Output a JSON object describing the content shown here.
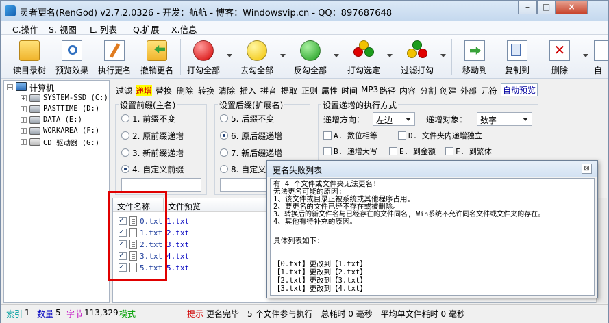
{
  "window": {
    "title": "灵者更名(RenGod) v2.7.2.0326 - 开发：航航 - 博客：Windowsvip.cn - QQ：897687648",
    "min_label": "–",
    "max_label": "□",
    "close_label": "×"
  },
  "menu": [
    "C.操作",
    "S. 视图",
    "L. 列表",
    "Q.扩展",
    "X.信息"
  ],
  "toolbar": {
    "buttons": [
      {
        "label": "读目录树",
        "icon": "folder-open-icon"
      },
      {
        "label": "预览效果",
        "icon": "preview-magnifier-icon"
      },
      {
        "label": "执行更名",
        "icon": "edit-document-icon"
      },
      {
        "label": "撤销更名",
        "icon": "undo-folder-icon"
      },
      {
        "label": "打勾全部",
        "icon": "red-circle-icon"
      },
      {
        "label": "去勾全部",
        "icon": "yellow-circle-icon"
      },
      {
        "label": "反勾全部",
        "icon": "green-circle-icon"
      },
      {
        "label": "打勾选定",
        "icon": "traffic-light-icon"
      },
      {
        "label": "过滤打勾",
        "icon": "traffic-filter-icon"
      },
      {
        "label": "移动到",
        "icon": "move-to-icon"
      },
      {
        "label": "复制到",
        "icon": "copy-to-icon"
      },
      {
        "label": "删除",
        "icon": "delete-icon"
      },
      {
        "label": "自",
        "icon": "auto-icon"
      }
    ]
  },
  "tree": {
    "root": "计算机",
    "drives": [
      "SYSTEM-SSD (C:)",
      "PASTTIME (D:)",
      "DATA (E:)",
      "WORKAREA (F:)",
      "CD 驱动器 (G:)"
    ]
  },
  "tabs": {
    "items": [
      "过滤",
      "递增",
      "替换",
      "删除",
      "转换",
      "清除",
      "插入",
      "拼音",
      "提取",
      "正则",
      "属性",
      "时间",
      "MP3",
      "路径",
      "内容",
      "分割",
      "创建",
      "外部",
      "元符"
    ],
    "active": "递增",
    "auto_preview": "自动预览"
  },
  "prefix_group": {
    "title": "设置前缀(主名)",
    "options": [
      "1. 前缀不变",
      "2. 原前缀递增",
      "3. 新前缀递增",
      "4. 自定义前缀"
    ],
    "selected_index": 3
  },
  "suffix_group": {
    "title": "设置后缀(扩展名)",
    "options": [
      "5. 后缀不变",
      "6. 原后缀递增",
      "7. 新后缀递增",
      "8. 自定义后"
    ],
    "selected_index": 1
  },
  "increment_group": {
    "title": "设置递增的执行方式",
    "direction_label": "递增方向：",
    "direction_value": "左边",
    "target_label": "递增对象：",
    "target_value": "数字",
    "checks": [
      "A. 数位相等",
      "D. 文件夹内递增独立",
      "B. 递增大写",
      "E. 到金额",
      "F. 到繁体"
    ]
  },
  "file_list": {
    "col_name": "文件名称",
    "col_preview": "文件预览",
    "rows": [
      {
        "name": "0.txt",
        "preview": "1.txt"
      },
      {
        "name": "1.txt",
        "preview": "2.txt"
      },
      {
        "name": "2.txt",
        "preview": "3.txt"
      },
      {
        "name": "3.txt",
        "preview": "4.txt"
      },
      {
        "name": "5.txt",
        "preview": "5.txt"
      }
    ]
  },
  "dialog": {
    "title": "更名失败列表",
    "close_label": "⊠",
    "lines": [
      "有 4 个文件或文件夹无法更名!",
      "无法更名可能的原因:",
      "1、该文件或目录正被系统或其他程序占用。",
      "2、要更名的文件已经不存在或被删除。",
      "3、转换后的新文件名与已经存在的文件同名, Win系统不允许同名文件或文件夹的存在。",
      "4、其他有待补充的原因。",
      "",
      "具体列表如下:",
      "",
      "",
      "【0.txt】更改到【1.txt】",
      "【1.txt】更改到【2.txt】",
      "【2.txt】更改到【3.txt】",
      "【3.txt】更改到【4.txt】"
    ]
  },
  "status": {
    "index_label": "索引",
    "index_value": "1",
    "count_label": "数量",
    "count_value": "5",
    "bytes_label": "字节",
    "bytes_value": "113,329",
    "mode_label": "模式",
    "tip_label": "提示",
    "tip_text": "更名完毕　5 个文件参与执行　总耗时 0 毫秒　平均单文件耗时 0 毫秒"
  }
}
